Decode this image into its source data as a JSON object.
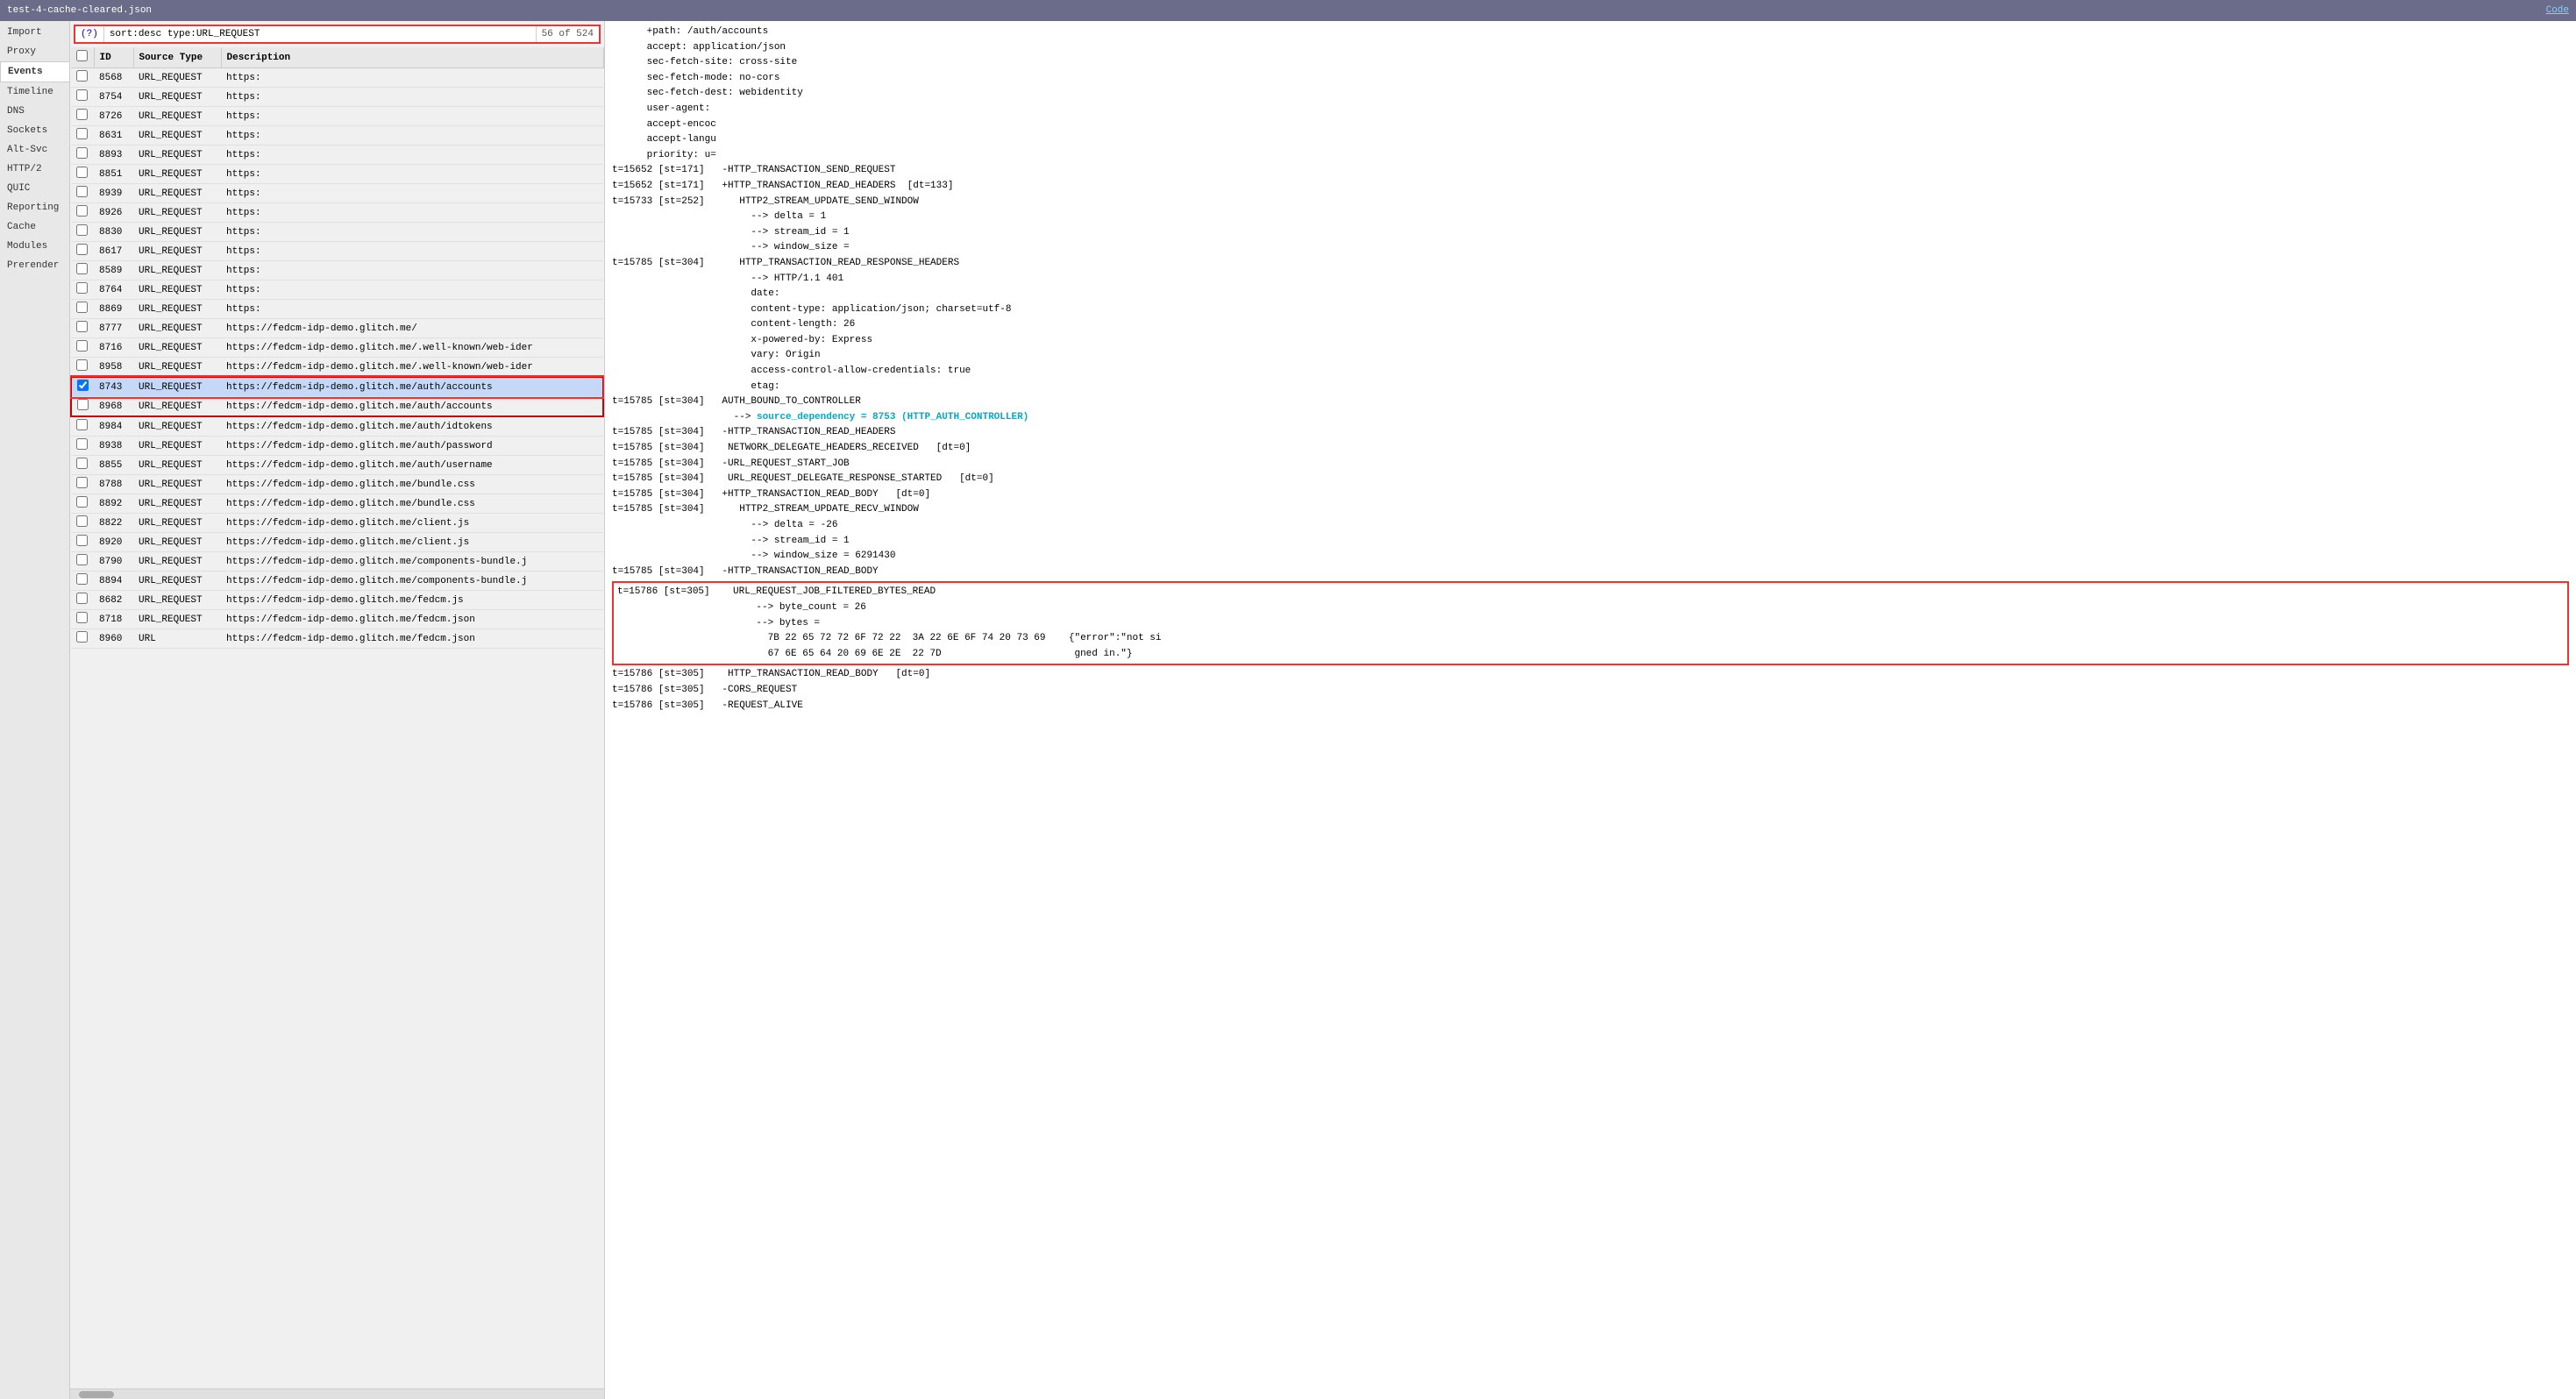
{
  "titleBar": {
    "title": "test-4-cache-cleared.json",
    "codeLink": "Code"
  },
  "sidebar": {
    "items": [
      {
        "id": "import",
        "label": "Import",
        "active": false
      },
      {
        "id": "proxy",
        "label": "Proxy",
        "active": false
      },
      {
        "id": "events",
        "label": "Events",
        "active": true
      },
      {
        "id": "timeline",
        "label": "Timeline",
        "active": false
      },
      {
        "id": "dns",
        "label": "DNS",
        "active": false
      },
      {
        "id": "sockets",
        "label": "Sockets",
        "active": false
      },
      {
        "id": "alt-svc",
        "label": "Alt-Svc",
        "active": false
      },
      {
        "id": "http2",
        "label": "HTTP/2",
        "active": false
      },
      {
        "id": "quic",
        "label": "QUIC",
        "active": false
      },
      {
        "id": "reporting",
        "label": "Reporting",
        "active": false
      },
      {
        "id": "cache",
        "label": "Cache",
        "active": false
      },
      {
        "id": "modules",
        "label": "Modules",
        "active": false
      },
      {
        "id": "prerender",
        "label": "Prerender",
        "active": false
      }
    ]
  },
  "searchBar": {
    "helpLabel": "(?)",
    "value": "sort:desc type:URL_REQUEST",
    "countLabel": "56 of 524"
  },
  "tableHeaders": [
    "",
    "ID",
    "Source Type",
    "Description"
  ],
  "tableRows": [
    {
      "id": "8568",
      "sourceType": "URL_REQUEST",
      "description": "https:",
      "checked": false,
      "selected": false
    },
    {
      "id": "8754",
      "sourceType": "URL_REQUEST",
      "description": "https:",
      "checked": false,
      "selected": false
    },
    {
      "id": "8726",
      "sourceType": "URL_REQUEST",
      "description": "https:",
      "checked": false,
      "selected": false
    },
    {
      "id": "8631",
      "sourceType": "URL_REQUEST",
      "description": "https:",
      "checked": false,
      "selected": false
    },
    {
      "id": "8893",
      "sourceType": "URL_REQUEST",
      "description": "https:",
      "checked": false,
      "selected": false
    },
    {
      "id": "8851",
      "sourceType": "URL_REQUEST",
      "description": "https:",
      "checked": false,
      "selected": false
    },
    {
      "id": "8939",
      "sourceType": "URL_REQUEST",
      "description": "https:",
      "checked": false,
      "selected": false
    },
    {
      "id": "8926",
      "sourceType": "URL_REQUEST",
      "description": "https:",
      "checked": false,
      "selected": false
    },
    {
      "id": "8830",
      "sourceType": "URL_REQUEST",
      "description": "https:",
      "checked": false,
      "selected": false
    },
    {
      "id": "8617",
      "sourceType": "URL_REQUEST",
      "description": "https:",
      "checked": false,
      "selected": false
    },
    {
      "id": "8589",
      "sourceType": "URL_REQUEST",
      "description": "https:",
      "checked": false,
      "selected": false
    },
    {
      "id": "8764",
      "sourceType": "URL_REQUEST",
      "description": "https:",
      "checked": false,
      "selected": false
    },
    {
      "id": "8869",
      "sourceType": "URL_REQUEST",
      "description": "https:",
      "checked": false,
      "selected": false
    },
    {
      "id": "8777",
      "sourceType": "URL_REQUEST",
      "description": "https://fedcm-idp-demo.glitch.me/",
      "checked": false,
      "selected": false
    },
    {
      "id": "8716",
      "sourceType": "URL_REQUEST",
      "description": "https://fedcm-idp-demo.glitch.me/.well-known/web-ider",
      "checked": false,
      "selected": false
    },
    {
      "id": "8958",
      "sourceType": "URL_REQUEST",
      "description": "https://fedcm-idp-demo.glitch.me/.well-known/web-ider",
      "checked": false,
      "selected": false
    },
    {
      "id": "8743",
      "sourceType": "URL_REQUEST",
      "description": "https://fedcm-idp-demo.glitch.me/auth/accounts",
      "checked": true,
      "selected": true,
      "highlighted": true
    },
    {
      "id": "8968",
      "sourceType": "URL_REQUEST",
      "description": "https://fedcm-idp-demo.glitch.me/auth/accounts",
      "checked": false,
      "selected": false,
      "inRedBox": true
    },
    {
      "id": "8984",
      "sourceType": "URL_REQUEST",
      "description": "https://fedcm-idp-demo.glitch.me/auth/idtokens",
      "checked": false,
      "selected": false
    },
    {
      "id": "8938",
      "sourceType": "URL_REQUEST",
      "description": "https://fedcm-idp-demo.glitch.me/auth/password",
      "checked": false,
      "selected": false
    },
    {
      "id": "8855",
      "sourceType": "URL_REQUEST",
      "description": "https://fedcm-idp-demo.glitch.me/auth/username",
      "checked": false,
      "selected": false
    },
    {
      "id": "8788",
      "sourceType": "URL_REQUEST",
      "description": "https://fedcm-idp-demo.glitch.me/bundle.css",
      "checked": false,
      "selected": false
    },
    {
      "id": "8892",
      "sourceType": "URL_REQUEST",
      "description": "https://fedcm-idp-demo.glitch.me/bundle.css",
      "checked": false,
      "selected": false
    },
    {
      "id": "8822",
      "sourceType": "URL_REQUEST",
      "description": "https://fedcm-idp-demo.glitch.me/client.js",
      "checked": false,
      "selected": false
    },
    {
      "id": "8920",
      "sourceType": "URL_REQUEST",
      "description": "https://fedcm-idp-demo.glitch.me/client.js",
      "checked": false,
      "selected": false
    },
    {
      "id": "8790",
      "sourceType": "URL_REQUEST",
      "description": "https://fedcm-idp-demo.glitch.me/components-bundle.j",
      "checked": false,
      "selected": false
    },
    {
      "id": "8894",
      "sourceType": "URL_REQUEST",
      "description": "https://fedcm-idp-demo.glitch.me/components-bundle.j",
      "checked": false,
      "selected": false
    },
    {
      "id": "8682",
      "sourceType": "URL_REQUEST",
      "description": "https://fedcm-idp-demo.glitch.me/fedcm.js",
      "checked": false,
      "selected": false
    },
    {
      "id": "8718",
      "sourceType": "URL_REQUEST",
      "description": "https://fedcm-idp-demo.glitch.me/fedcm.json",
      "checked": false,
      "selected": false
    },
    {
      "id": "8960",
      "sourceType": "URL",
      "description": "https://fedcm-idp-demo.glitch.me/fedcm.json",
      "checked": false,
      "selected": false
    }
  ],
  "detailPanel": {
    "lines": [
      {
        "text": "      +path: /auth/accounts",
        "type": "normal"
      },
      {
        "text": "      accept: application/json",
        "type": "normal"
      },
      {
        "text": "      sec-fetch-site: cross-site",
        "type": "normal"
      },
      {
        "text": "      sec-fetch-mode: no-cors",
        "type": "normal"
      },
      {
        "text": "      sec-fetch-dest: webidentity",
        "type": "normal"
      },
      {
        "text": "      user-agent:",
        "type": "normal"
      },
      {
        "text": "      accept-encoc",
        "type": "normal"
      },
      {
        "text": "      accept-langu",
        "type": "normal"
      },
      {
        "text": "      priority: u=",
        "type": "normal"
      },
      {
        "text": "t=15652 [st=171]   -HTTP_TRANSACTION_SEND_REQUEST",
        "type": "normal"
      },
      {
        "text": "t=15652 [st=171]   +HTTP_TRANSACTION_READ_HEADERS  [dt=133]",
        "type": "normal"
      },
      {
        "text": "t=15733 [st=252]      HTTP2_STREAM_UPDATE_SEND_WINDOW",
        "type": "normal"
      },
      {
        "text": "                        --> delta = 1",
        "type": "normal"
      },
      {
        "text": "                        --> stream_id = 1",
        "type": "normal"
      },
      {
        "text": "                        --> window_size =",
        "type": "normal"
      },
      {
        "text": "t=15785 [st=304]      HTTP_TRANSACTION_READ_RESPONSE_HEADERS",
        "type": "normal"
      },
      {
        "text": "                        --> HTTP/1.1 401",
        "type": "normal"
      },
      {
        "text": "                        date:",
        "type": "normal"
      },
      {
        "text": "                        content-type: application/json; charset=utf-8",
        "type": "normal"
      },
      {
        "text": "                        content-length: 26",
        "type": "normal"
      },
      {
        "text": "                        x-powered-by: Express",
        "type": "normal"
      },
      {
        "text": "                        vary: Origin",
        "type": "normal"
      },
      {
        "text": "                        access-control-allow-credentials: true",
        "type": "normal"
      },
      {
        "text": "                        etag:",
        "type": "normal"
      },
      {
        "text": "t=15785 [st=304]   AUTH_BOUND_TO_CONTROLLER",
        "type": "normal"
      },
      {
        "text": "                     --> source_dependency = 8753 (HTTP_AUTH_CONTROLLER)",
        "type": "cyan-link"
      },
      {
        "text": "t=15785 [st=304]   -HTTP_TRANSACTION_READ_HEADERS",
        "type": "normal"
      },
      {
        "text": "t=15785 [st=304]    NETWORK_DELEGATE_HEADERS_RECEIVED   [dt=0]",
        "type": "normal"
      },
      {
        "text": "t=15785 [st=304]   -URL_REQUEST_START_JOB",
        "type": "normal"
      },
      {
        "text": "t=15785 [st=304]    URL_REQUEST_DELEGATE_RESPONSE_STARTED   [dt=0]",
        "type": "normal"
      },
      {
        "text": "t=15785 [st=304]   +HTTP_TRANSACTION_READ_BODY   [dt=0]",
        "type": "normal"
      },
      {
        "text": "t=15785 [st=304]      HTTP2_STREAM_UPDATE_RECV_WINDOW",
        "type": "normal"
      },
      {
        "text": "                        --> delta = -26",
        "type": "normal"
      },
      {
        "text": "                        --> stream_id = 1",
        "type": "normal"
      },
      {
        "text": "                        --> window_size = 6291430",
        "type": "normal"
      },
      {
        "text": "t=15785 [st=304]   -HTTP_TRANSACTION_READ_BODY",
        "type": "normal"
      },
      {
        "text": "t=15786 [st=305]    URL_REQUEST_JOB_FILTERED_BYTES_READ",
        "type": "highlight-start"
      },
      {
        "text": "                        --> byte_count = 26",
        "type": "highlight"
      },
      {
        "text": "                        --> bytes =",
        "type": "highlight"
      },
      {
        "text": "                          7B 22 65 72 72 6F 72 22  3A 22 6E 6F 74 20 73 69    {\"error\":\"not si",
        "type": "highlight"
      },
      {
        "text": "                          67 6E 65 64 20 69 6E 2E  22 7D                       gned in.\"}",
        "type": "highlight"
      },
      {
        "text": "t=15786 [st=305]    HTTP_TRANSACTION_READ_BODY   [dt=0]",
        "type": "normal"
      },
      {
        "text": "t=15786 [st=305]   -CORS_REQUEST",
        "type": "normal"
      },
      {
        "text": "t=15786 [st=305]   -REQUEST_ALIVE",
        "type": "normal"
      }
    ]
  }
}
